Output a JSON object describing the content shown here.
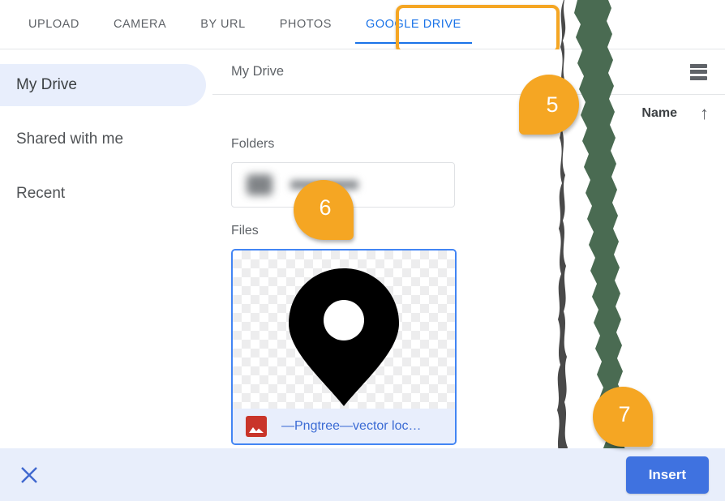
{
  "tabs": [
    {
      "label": "UPLOAD",
      "active": false
    },
    {
      "label": "CAMERA",
      "active": false
    },
    {
      "label": "BY URL",
      "active": false
    },
    {
      "label": "PHOTOS",
      "active": false
    },
    {
      "label": "GOOGLE DRIVE",
      "active": true
    }
  ],
  "sidebar": {
    "items": [
      {
        "label": "My Drive",
        "selected": true
      },
      {
        "label": "Shared with me",
        "selected": false
      },
      {
        "label": "Recent",
        "selected": false
      }
    ]
  },
  "content": {
    "breadcrumb": "My Drive",
    "view_toggle_icon": "list-view-icon",
    "sort": {
      "column_label": "Name",
      "direction_icon": "arrow-up-icon",
      "direction": "ascending"
    },
    "folders_label": "Folders",
    "files_label": "Files",
    "folder_items": [
      {
        "name": "",
        "blurred": true
      }
    ],
    "file_items": [
      {
        "name": "—Pngtree—vector loc…",
        "type_icon": "image-file-icon",
        "selected": true,
        "thumbnail": "location-pin-graphic"
      }
    ]
  },
  "footer": {
    "close_icon": "close-icon",
    "insert_label": "Insert"
  },
  "annotations": {
    "badges": [
      {
        "number": "5",
        "direction": "down-left"
      },
      {
        "number": "6",
        "direction": "down-right"
      },
      {
        "number": "7",
        "direction": "down-right"
      }
    ],
    "highlight_target": "GOOGLE DRIVE"
  },
  "colors": {
    "accent_blue": "#1a73e8",
    "annotation_orange": "#f5a623",
    "insert_blue": "#3f72e0",
    "selected_pill": "#e8eefc",
    "footer_bg": "#e8eefb",
    "overlay_green": "#4a6b52",
    "file_icon_red": "#c9352a"
  }
}
